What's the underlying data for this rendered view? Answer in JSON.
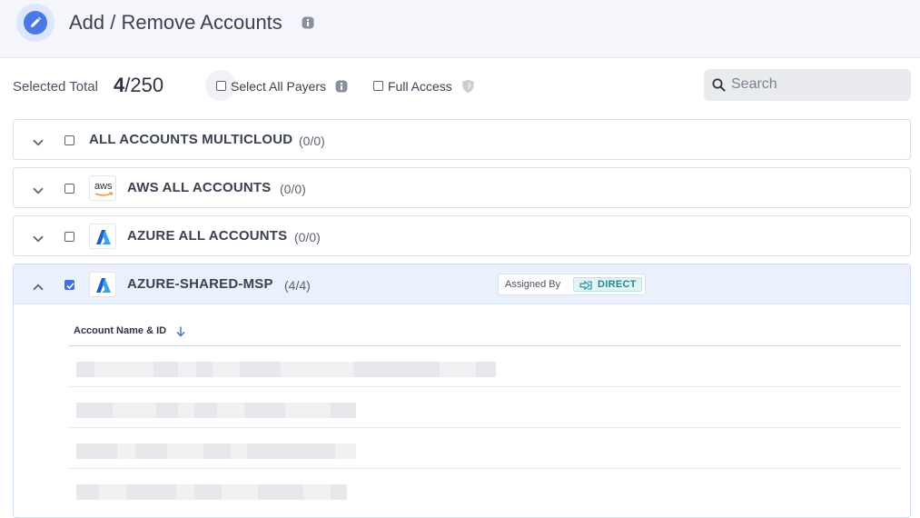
{
  "header": {
    "title": "Add / Remove Accounts",
    "edit_icon": "pencil-icon",
    "info_icon": "info-icon"
  },
  "toolbar": {
    "selected_label": "Selected Total",
    "selected_count": "4",
    "selected_total": "/250",
    "select_all_payers_label": "Select All Payers",
    "full_access_label": "Full Access",
    "search_placeholder": "Search"
  },
  "groups": [
    {
      "name": "ALL ACCOUNTS MULTICLOUD",
      "count": "(0/0)",
      "logo": "none",
      "checked": false,
      "expanded": false
    },
    {
      "name": "AWS ALL ACCOUNTS",
      "count": "(0/0)",
      "logo": "aws-logo",
      "logo_text": "aws",
      "checked": false,
      "expanded": false
    },
    {
      "name": "AZURE ALL ACCOUNTS",
      "count": "(0/0)",
      "logo": "azure-logo",
      "checked": false,
      "expanded": false
    },
    {
      "name": "AZURE-SHARED-MSP",
      "count": "(4/4)",
      "logo": "azure-logo",
      "checked": true,
      "expanded": true,
      "assigned_by_label": "Assigned By",
      "assigned_type": "DIRECT"
    }
  ],
  "table": {
    "column_header": "Account Name & ID",
    "row_count": 4
  },
  "colors": {
    "accent": "#3f6fdc",
    "header_bg": "#f4f6fb",
    "expanded_bg": "#eaf0fc",
    "direct_text": "#1a8a96"
  }
}
